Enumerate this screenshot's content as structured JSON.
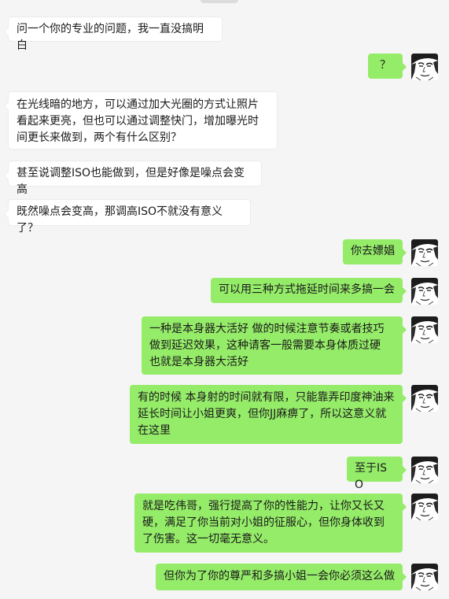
{
  "chat": {
    "messages": [
      {
        "side": "left",
        "text": "问一个你的专业的问题，我一直没搞明白"
      },
      {
        "side": "right",
        "text": "？"
      },
      {
        "side": "left",
        "text": "在光线暗的地方，可以通过加大光圈的方式让照片看起来更亮，但也可以通过调整快门，增加曝光时间更长来做到，两个有什么区别？"
      },
      {
        "side": "left",
        "text": "甚至说调整ISO也能做到，但是好像是噪点会变高"
      },
      {
        "side": "left",
        "text": "既然噪点会变高，那调高ISO不就没有意义了？"
      },
      {
        "side": "right",
        "text": "你去嫖娼"
      },
      {
        "side": "right",
        "text": "可以用三种方式拖延时间来多搞一会"
      },
      {
        "side": "right",
        "text": "一种是本身器大活好 做的时候注意节奏或者技巧做到延迟效果，这种请客一般需要本身体质过硬 也就是本身器大活好"
      },
      {
        "side": "right",
        "text": "有的时候 本身射的时间就有限，只能靠弄印度神油来延长时间让小姐更爽，但你JJ麻痹了，所以这意义就在这里"
      },
      {
        "side": "right",
        "text": "至于ISO"
      },
      {
        "side": "right",
        "text": "就是吃伟哥，强行提高了你的性能力，让你又长又硬，满足了你当前对小姐的征服心，但你身体收到了伤害。这一切毫无意义。"
      },
      {
        "side": "right",
        "text": "但你为了你的尊严和多搞小姐一会你必须这么做"
      }
    ]
  }
}
